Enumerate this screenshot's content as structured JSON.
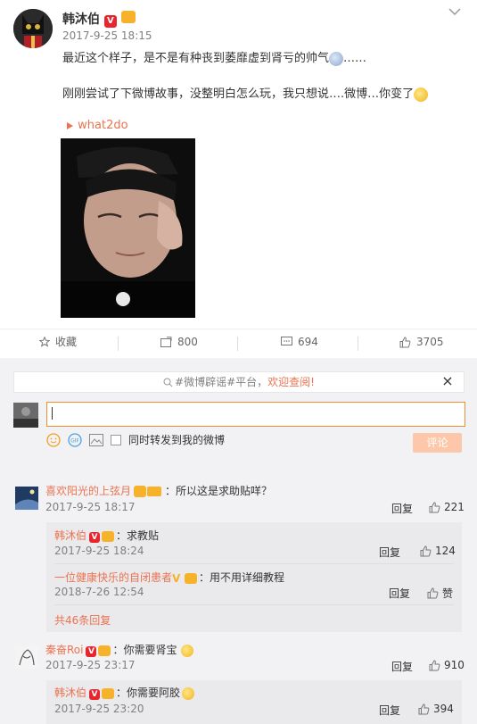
{
  "post": {
    "author": "韩沐伯",
    "timestamp": "2017-9-25 18:15",
    "line1_text": "最近这个样子，是不是有种丧到萎靡虚到肾亏的帅气",
    "line1_tail": "……",
    "line2_text": "刚刚尝试了下微博故事，没整明白怎么玩，我只想说….微博…你变了",
    "link_label": "what2do"
  },
  "actions": {
    "favorite_label": "收藏",
    "repost_count": "800",
    "comment_count": "694",
    "like_count": "3705"
  },
  "notice": {
    "prefix": "#微博辟谣#平台，",
    "highlight": "欢迎查阅!"
  },
  "composer": {
    "input_value": "",
    "repost_checkbox_label": "同时转发到我的微博",
    "submit_label": "评论"
  },
  "comments": [
    {
      "user": "喜欢阳光的上弦月",
      "text": "：所以这是求助贴咩？",
      "time": "2017-9-25 18:17",
      "reply_label": "回复",
      "likes": "221",
      "replies": [
        {
          "user": "韩沐伯",
          "text": "：求教贴",
          "time": "2017-9-25 18:24",
          "reply_label": "回复",
          "likes": "124"
        },
        {
          "user": "一位健康快乐的自闭患者",
          "text": "：用不用详细教程",
          "time": "2018-7-26 12:54",
          "reply_label": "回复",
          "likes": "赞"
        }
      ],
      "more_replies": "共46条回复"
    },
    {
      "user": "秦奋Roi",
      "text": "：你需要肾宝",
      "time": "2017-9-25 23:17",
      "reply_label": "回复",
      "likes": "910",
      "replies": [
        {
          "user": "韩沐伯",
          "text": "：你需要阿胶",
          "time": "2017-9-25 23:20",
          "reply_label": "回复",
          "likes": "394"
        }
      ]
    }
  ],
  "colors": {
    "accent": "#eb7350",
    "verified": "#e8242c",
    "submit_disabled": "#fdc8a9",
    "panel": "#f2f2f5"
  }
}
